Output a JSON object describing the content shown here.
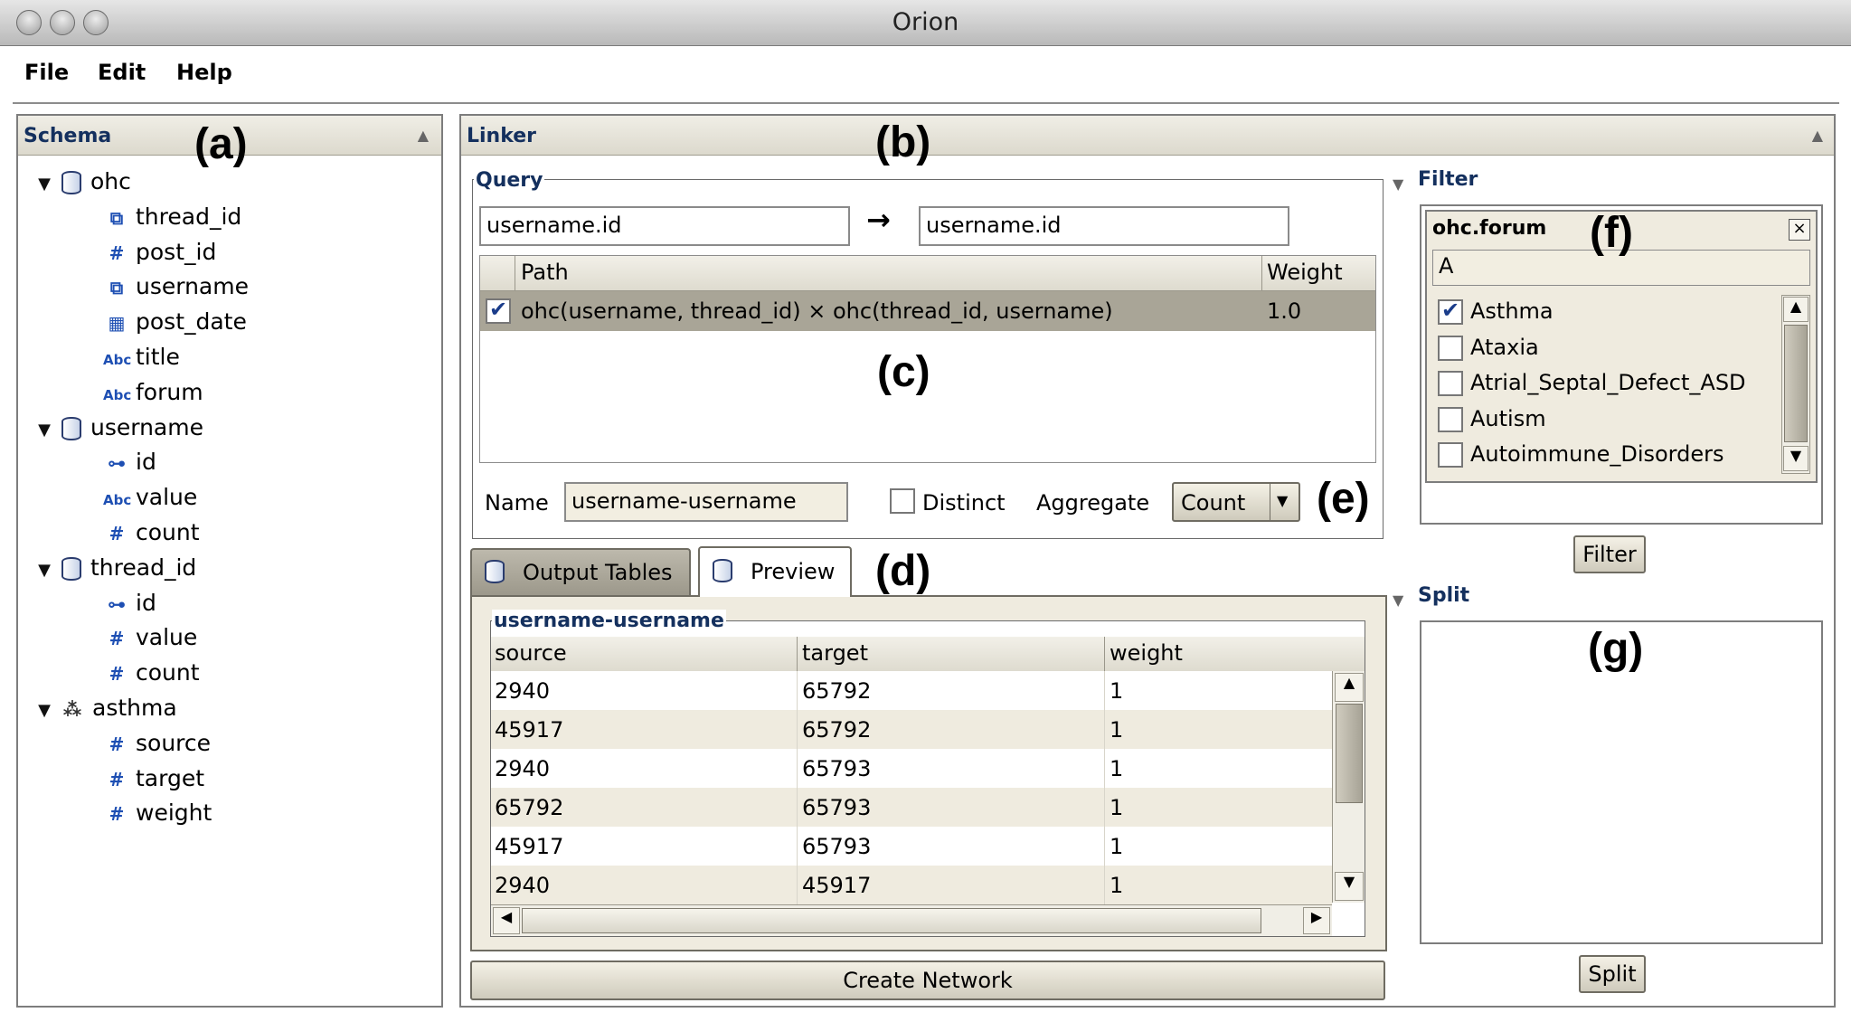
{
  "window": {
    "title": "Orion"
  },
  "menu": [
    "File",
    "Edit",
    "Help"
  ],
  "schema": {
    "title": "Schema",
    "annotation": "(a)",
    "tables": [
      {
        "name": "ohc",
        "icon": "database-icon",
        "fields": [
          {
            "name": "thread_id",
            "icon": "link-icon"
          },
          {
            "name": "post_id",
            "icon": "number-icon"
          },
          {
            "name": "username",
            "icon": "link-icon"
          },
          {
            "name": "post_date",
            "icon": "calendar-icon"
          },
          {
            "name": "title",
            "icon": "text-icon"
          },
          {
            "name": "forum",
            "icon": "text-icon"
          }
        ]
      },
      {
        "name": "username",
        "icon": "database-icon",
        "fields": [
          {
            "name": "id",
            "icon": "key-icon"
          },
          {
            "name": "value",
            "icon": "text-icon"
          },
          {
            "name": "count",
            "icon": "number-icon"
          }
        ]
      },
      {
        "name": "thread_id",
        "icon": "database-icon",
        "fields": [
          {
            "name": "id",
            "icon": "key-icon"
          },
          {
            "name": "value",
            "icon": "number-icon"
          },
          {
            "name": "count",
            "icon": "number-icon"
          }
        ]
      },
      {
        "name": "asthma",
        "icon": "network-icon",
        "fields": [
          {
            "name": "source",
            "icon": "number-icon"
          },
          {
            "name": "target",
            "icon": "number-icon"
          },
          {
            "name": "weight",
            "icon": "number-icon"
          }
        ]
      }
    ],
    "icon_glyphs": {
      "text": "Abc",
      "number": "#",
      "key": "⊶",
      "link": "⧉",
      "calendar": "▦",
      "network": "⁂"
    }
  },
  "linker": {
    "title": "Linker",
    "annotation": "(b)",
    "query": {
      "label": "Query",
      "source": "username.id",
      "arrow": "→",
      "target": "username.id",
      "columns": [
        "Path",
        "Weight"
      ],
      "rows": [
        {
          "checked": true,
          "path": "ohc(username, thread_id) × ohc(thread_id, username)",
          "weight": "1.0"
        }
      ],
      "annotation": "(c)"
    },
    "name_label": "Name",
    "name_value": "username-username",
    "distinct_label": "Distinct",
    "aggregate_label": "Aggregate",
    "aggregate_value": "Count",
    "annotation_e": "(e)",
    "tabs": [
      "Output Tables",
      "Preview"
    ],
    "annotation_d": "(d)",
    "preview": {
      "label": "username-username",
      "columns": [
        "source",
        "target",
        "weight"
      ],
      "rows": [
        [
          "2940",
          "65792",
          "1"
        ],
        [
          "45917",
          "65792",
          "1"
        ],
        [
          "2940",
          "65793",
          "1"
        ],
        [
          "65792",
          "65793",
          "1"
        ],
        [
          "45917",
          "65793",
          "1"
        ],
        [
          "2940",
          "45917",
          "1"
        ]
      ]
    },
    "create_button": "Create Network"
  },
  "filter": {
    "title": "Filter",
    "box_title": "ohc.forum",
    "annotation": "(f)",
    "search": "A",
    "close": "×",
    "items": [
      {
        "label": "Asthma",
        "checked": true
      },
      {
        "label": "Ataxia",
        "checked": false
      },
      {
        "label": "Atrial_Septal_Defect_ASD",
        "checked": false
      },
      {
        "label": "Autism",
        "checked": false
      },
      {
        "label": "Autoimmune_Disorders",
        "checked": false
      }
    ],
    "button": "Filter"
  },
  "split": {
    "title": "Split",
    "annotation": "(g)",
    "button": "Split"
  },
  "colors": {
    "header_text": "#14305e",
    "icon_blue": "#1e4fb3",
    "selected_row": "#a9a597",
    "stripe": "#efebdf"
  }
}
